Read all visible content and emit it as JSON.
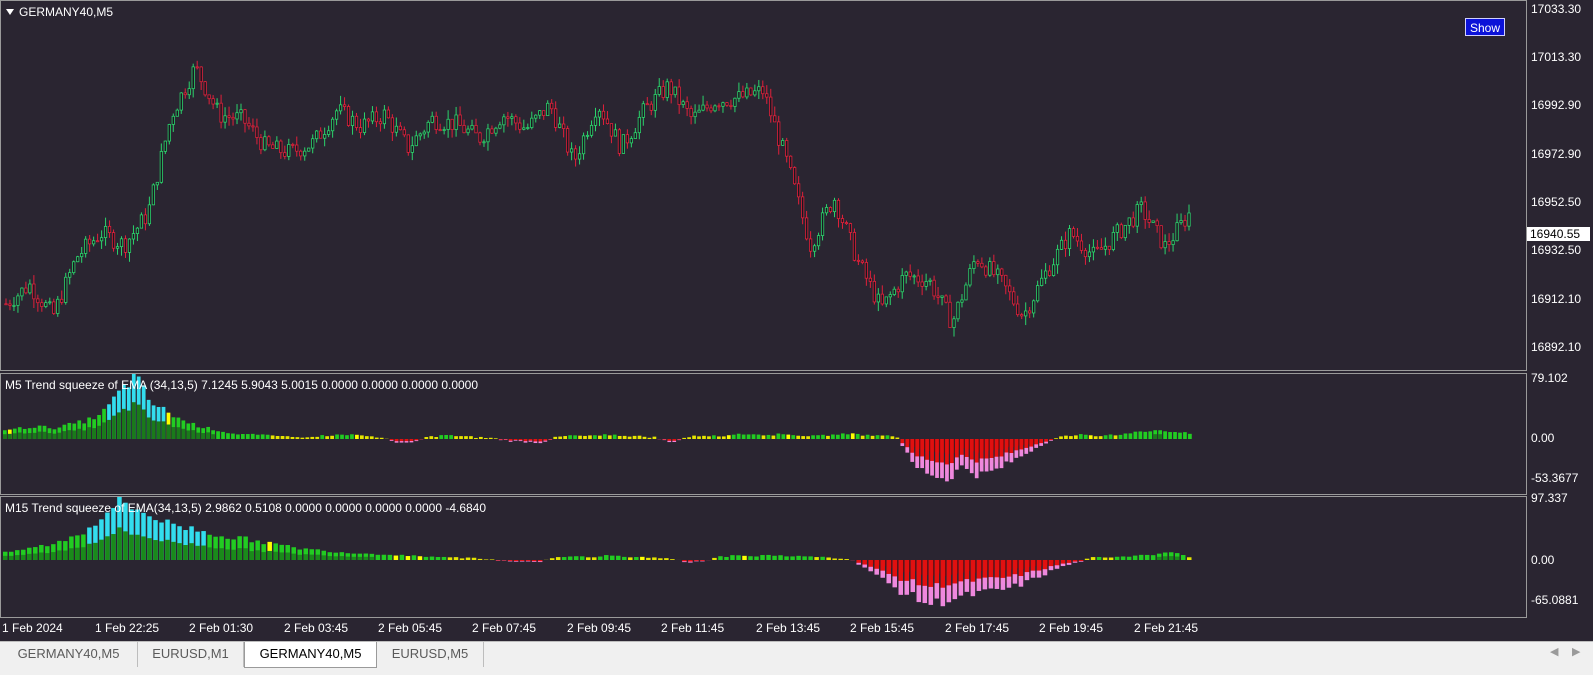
{
  "main_chart": {
    "title": "GERMANY40,M5",
    "show_button": "Show",
    "price_labels": [
      "17033.30",
      "17013.30",
      "16992.90",
      "16972.90",
      "16952.50",
      "16932.50",
      "16912.10",
      "16892.10"
    ],
    "current_price": "16940.55"
  },
  "indicator1": {
    "title": "M5 Trend squeeze of EMA (34,13,5) 7.1245 5.9043 5.0015 0.0000 0.0000 0.0000 0.0000",
    "labels": [
      "79.102",
      "0.00",
      "-53.3677"
    ]
  },
  "indicator2": {
    "title": "M15 Trend squeeze of EMA(34,13,5) 2.9862 0.5108 0.0000 0.0000 0.0000 0.0000 -4.6840",
    "labels": [
      "97.337",
      "0.00",
      "-65.0881"
    ]
  },
  "time_axis": [
    "1 Feb 2024",
    "1 Feb 22:25",
    "2 Feb 01:30",
    "2 Feb 03:45",
    "2 Feb 05:45",
    "2 Feb 07:45",
    "2 Feb 09:45",
    "2 Feb 11:45",
    "2 Feb 13:45",
    "2 Feb 15:45",
    "2 Feb 17:45",
    "2 Feb 19:45",
    "2 Feb 21:45"
  ],
  "tabs": [
    {
      "label": "GERMANY40,M5",
      "active": false
    },
    {
      "label": "EURUSD,M1",
      "active": false
    },
    {
      "label": "GERMANY40,M5",
      "active": true
    },
    {
      "label": "EURUSD,M5",
      "active": false
    }
  ],
  "colors": {
    "background": "#2a2531",
    "bull": "#2bd36b",
    "bear": "#e0203a",
    "show_button": "#0b12d8"
  },
  "chart_data": [
    {
      "type": "candlestick",
      "title": "GERMANY40,M5",
      "ylim": [
        16882,
        17038
      ],
      "close_anchors": [
        16910,
        16918,
        16905,
        16930,
        16940,
        16935,
        16948,
        16990,
        17010,
        16990,
        16988,
        16976,
        16974,
        16978,
        16992,
        16985,
        16990,
        16976,
        16988,
        16986,
        16980,
        16990,
        16984,
        16994,
        16970,
        16995,
        16976,
        16992,
        17002,
        16988,
        16996,
        16997,
        17000,
        16970,
        16935,
        16955,
        16928,
        16908,
        16922,
        16920,
        16902,
        16930,
        16920,
        16905,
        16924,
        16940,
        16930,
        16940,
        16950,
        16934,
        16948
      ]
    },
    {
      "type": "histogram",
      "title": "M5 Trend squeeze of EMA (34,13,5)",
      "ylim": [
        -53.3677,
        79.102
      ],
      "values": [
        10,
        12,
        14,
        12,
        16,
        20,
        28,
        50,
        70,
        40,
        30,
        20,
        14,
        10,
        6,
        5,
        4,
        3,
        2,
        3,
        4,
        5,
        4,
        2,
        -3,
        -5,
        2,
        4,
        3,
        2,
        1,
        -2,
        -3,
        -4,
        2,
        4,
        3,
        5,
        4,
        3,
        2,
        -4,
        2,
        4,
        3,
        6,
        5,
        4,
        6,
        4,
        3,
        5,
        6,
        4,
        5,
        2,
        -30,
        -38,
        -45,
        -30,
        -40,
        -35,
        -25,
        -15,
        -5,
        2,
        5,
        3,
        4,
        6,
        8,
        10,
        8,
        6
      ]
    },
    {
      "type": "histogram",
      "title": "M15 Trend squeeze of EMA(34,13,5)",
      "ylim": [
        -65.0881,
        97.337
      ],
      "values": [
        10,
        14,
        18,
        22,
        30,
        40,
        60,
        80,
        70,
        60,
        50,
        45,
        40,
        35,
        30,
        28,
        24,
        20,
        16,
        14,
        12,
        10,
        9,
        8,
        7,
        6,
        5,
        4,
        3,
        2,
        1,
        -2,
        -3,
        -2,
        3,
        5,
        4,
        6,
        5,
        4,
        3,
        2,
        -3,
        -2,
        4,
        6,
        5,
        7,
        6,
        5,
        4,
        3,
        2,
        -10,
        -25,
        -40,
        -50,
        -60,
        -55,
        -50,
        -45,
        -42,
        -38,
        -30,
        -20,
        -10,
        -4,
        3,
        4,
        5,
        6,
        8,
        10,
        4
      ]
    }
  ]
}
